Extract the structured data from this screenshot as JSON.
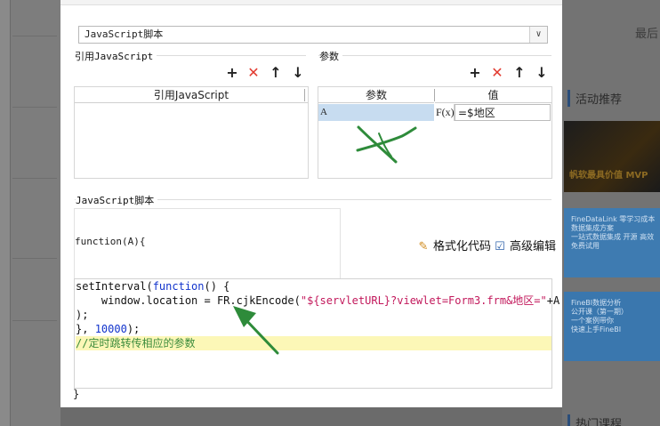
{
  "background": {
    "recent_label": "最后",
    "activity_title": "活动推荐",
    "banner1_text": "帆软最具价值 MVP",
    "banner2_text": "FineDataLink 零学习成本\n数据集成方案\n一站式数据集成 开源 高效\n免费试用",
    "banner3_text": "FineBI数据分析\n公开课（第一期）\n一个案例带你\n快速上手FineBI",
    "hot_courses": "热门课程"
  },
  "dialog": {
    "type_select": {
      "value": "JavaScript脚本"
    },
    "ref_js": {
      "title": "引用JavaScript",
      "column": "引用JavaScript",
      "rows": []
    },
    "params": {
      "title": "参数",
      "columns": [
        "参数",
        "值"
      ],
      "rows": [
        {
          "name": "A",
          "fx": "F(x)",
          "value": "=$地区"
        }
      ]
    },
    "toolbar_icons": [
      "plus-icon",
      "delete-x-icon",
      "arrow-up-icon",
      "arrow-down-icon"
    ],
    "script": {
      "title": "JavaScript脚本",
      "function_head": "function(A){",
      "format_code_label": "格式化代码",
      "advanced_edit_label": "高级编辑",
      "code": {
        "l1_a": "setInterval(",
        "l1_kw": "function",
        "l1_b": "() {",
        "l2_a": "    window.location = FR.cjkEncode(",
        "l2_str": "\"${servletURL}?viewlet=Form3.frm&地区=\"",
        "l2_b": "+A",
        "l3": ");",
        "l4_a": "}, ",
        "l4_num": "10000",
        "l4_b": ");",
        "l5": "//定时跳转传相应的参数"
      },
      "function_close": "}"
    }
  },
  "colors": {
    "accent_red": "#e23b30",
    "annotation_green": "#2e8b3a",
    "highlight": "#fcf7b7",
    "selected_row": "#c7dcf0"
  }
}
